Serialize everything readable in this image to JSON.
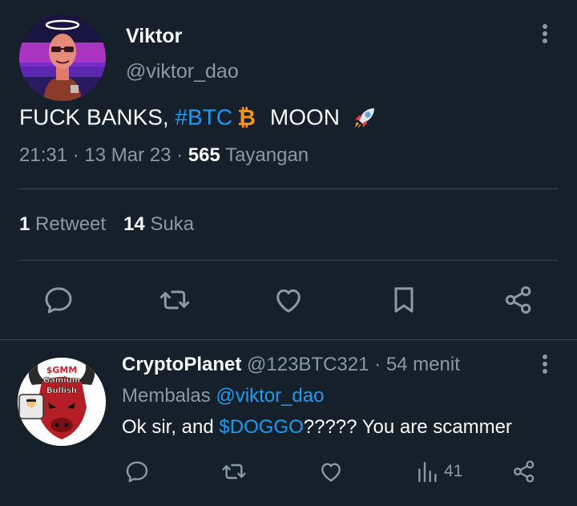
{
  "tweet": {
    "author_name": "Viktor",
    "author_handle": "@viktor_dao",
    "text_prefix": "FUCK BANKS, ",
    "hashtag": "#BTC",
    "btc_symbol": "₿",
    "text_suffix": "MOON",
    "time": "21:31",
    "sep1": " · ",
    "date": "13 Mar 23",
    "sep2": " · ",
    "views_count": "565",
    "views_label": " Tayangan",
    "retweet_count": "1",
    "retweet_label": " Retweet",
    "like_count": "14",
    "like_label": " Suka",
    "icons": {
      "more": "more-vertical-icon",
      "reply": "reply-icon",
      "retweet": "retweet-icon",
      "like": "heart-icon",
      "bookmark": "bookmark-icon",
      "share": "share-icon",
      "rocket": "rocket-emoji"
    }
  },
  "reply": {
    "author_name": "CryptoPlanet",
    "author_handle": " @123BTC321",
    "sep": " · ",
    "time_ago": "54 menit",
    "replying_prefix": "Membalas ",
    "replying_handle": "@viktor_dao",
    "text_prefix": "Ok sir, and ",
    "cashtag": "$DOGGO",
    "text_suffix": "????? You are scammer",
    "views_count": "41",
    "avatar_text_top": "$GMM",
    "avatar_text_mid": "Gamium",
    "avatar_text_bottom": "Bullish"
  },
  "colors": {
    "background": "#15202b",
    "text": "#f7f9f9",
    "muted": "#8b98a5",
    "link": "#1d9bf0",
    "divider": "#38444d",
    "bitcoin": "#f7931a"
  }
}
